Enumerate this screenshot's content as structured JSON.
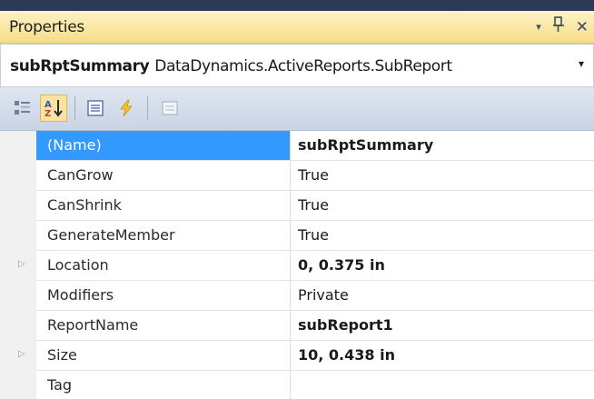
{
  "panel": {
    "title": "Properties",
    "dropdown_glyph": "▾",
    "pin_glyph": "ⅎ",
    "close_glyph": "✕"
  },
  "object_selector": {
    "object_name": "subRptSummary",
    "object_type": "DataDynamics.ActiveReports.SubReport",
    "dropdown_glyph": "▾"
  },
  "toolbar": {
    "buttons": [
      {
        "icon": "categorized-icon"
      },
      {
        "icon": "alphabetical-sort-icon",
        "active": true
      },
      {
        "icon": "properties-icon"
      },
      {
        "icon": "events-icon"
      },
      {
        "icon": "property-pages-icon"
      }
    ]
  },
  "properties": [
    {
      "name": "(Name)",
      "value": "subRptSummary",
      "bold": true,
      "selected": true,
      "expandable": false
    },
    {
      "name": "CanGrow",
      "value": "True",
      "bold": false,
      "selected": false,
      "expandable": false
    },
    {
      "name": "CanShrink",
      "value": "True",
      "bold": false,
      "selected": false,
      "expandable": false
    },
    {
      "name": "GenerateMember",
      "value": "True",
      "bold": false,
      "selected": false,
      "expandable": false
    },
    {
      "name": "Location",
      "value": "0, 0.375 in",
      "bold": true,
      "selected": false,
      "expandable": true
    },
    {
      "name": "Modifiers",
      "value": "Private",
      "bold": false,
      "selected": false,
      "expandable": false
    },
    {
      "name": "ReportName",
      "value": "subReport1",
      "bold": true,
      "selected": false,
      "expandable": false
    },
    {
      "name": "Size",
      "value": "10, 0.438 in",
      "bold": true,
      "selected": false,
      "expandable": true
    },
    {
      "name": "Tag",
      "value": "",
      "bold": false,
      "selected": false,
      "expandable": false
    }
  ],
  "colors": {
    "titlebar": "#f5dc86",
    "selection": "#3399ff",
    "toolbar": "#d3dcea"
  }
}
